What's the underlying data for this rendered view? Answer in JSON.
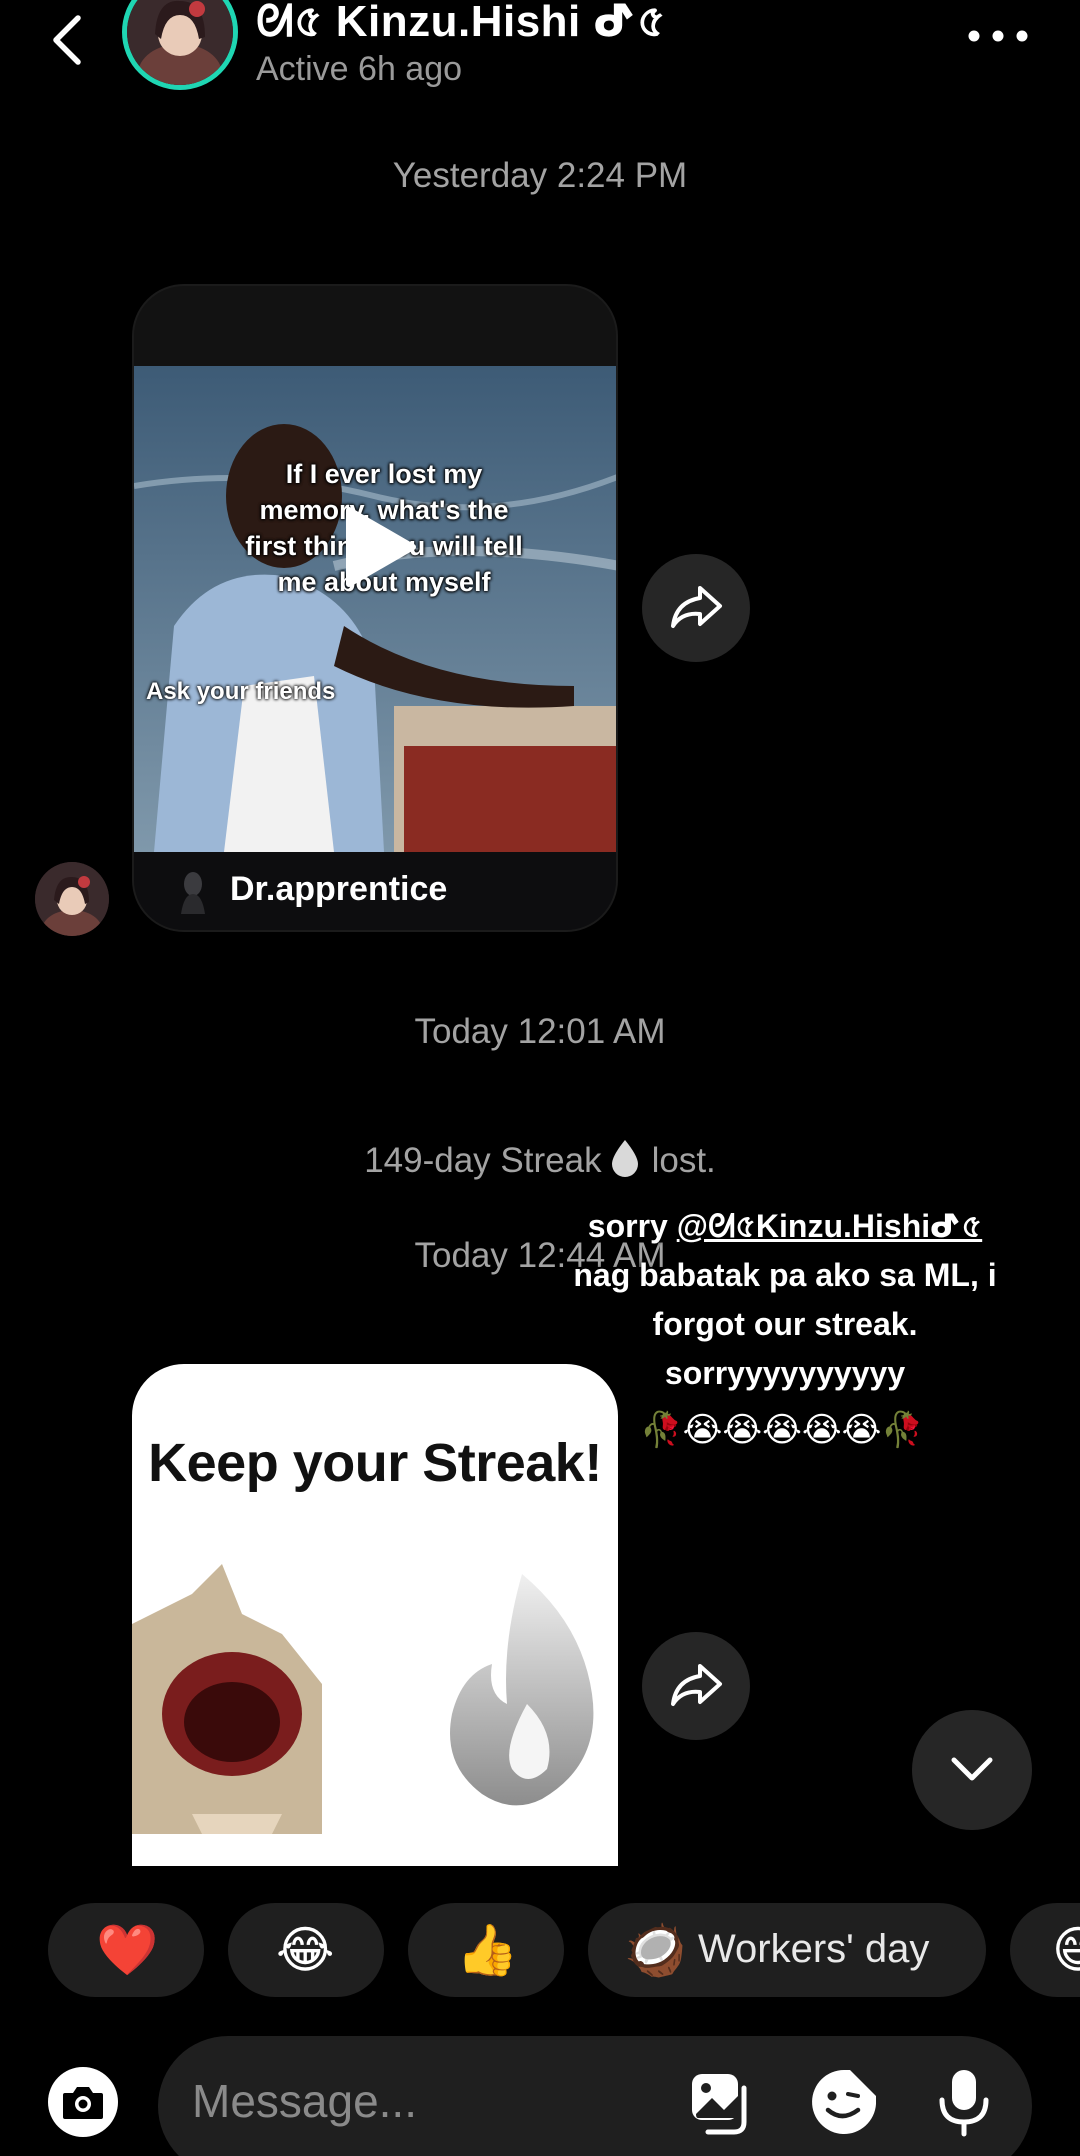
{
  "header": {
    "contact_name": "ᘛ৫ Kinzu.Hishi ᕷ৫",
    "status": "Active 6h ago"
  },
  "messages": {
    "timestamp_1": "Yesterday 2:24 PM",
    "video": {
      "caption": "If I ever lost my memory, what's the first thing you will tell me about myself",
      "subcaption": "Ask your friends",
      "author": "Dr.apprentice"
    },
    "timestamp_2": "Today 12:01 AM",
    "streak_text": "149-day Streak",
    "streak_suffix": "lost.",
    "timestamp_3": "Today 12:44 AM",
    "sticker_title": "Keep your Streak!"
  },
  "overlay_caption": {
    "prefix": "sorry ",
    "mention": "@ᘛ৫Kinzu.Hishiᕷ৫",
    "body": "nag babatak pa ako sa ML, i forgot our streak. sorryyyyyyyyyy",
    "emojis": "🥀😭😭😭😭😭🥀"
  },
  "quick_reactions": [
    {
      "emoji": "❤️"
    },
    {
      "emoji": "😂"
    },
    {
      "emoji": "👍"
    },
    {
      "emoji": "🥥",
      "label": "Workers' day"
    },
    {
      "emoji": "😄"
    }
  ],
  "composer": {
    "placeholder": "Message..."
  },
  "icons": [
    "back-icon",
    "more-icon",
    "play-icon",
    "share-icon",
    "drop-icon",
    "chevron-down-icon",
    "camera-icon",
    "gallery-icon",
    "sticker-icon",
    "microphone-icon"
  ],
  "colors": {
    "background": "#000000",
    "avatar_ring": "#1fd6b3",
    "bubble": "#262626",
    "muted_text": "#a3a3a3"
  }
}
